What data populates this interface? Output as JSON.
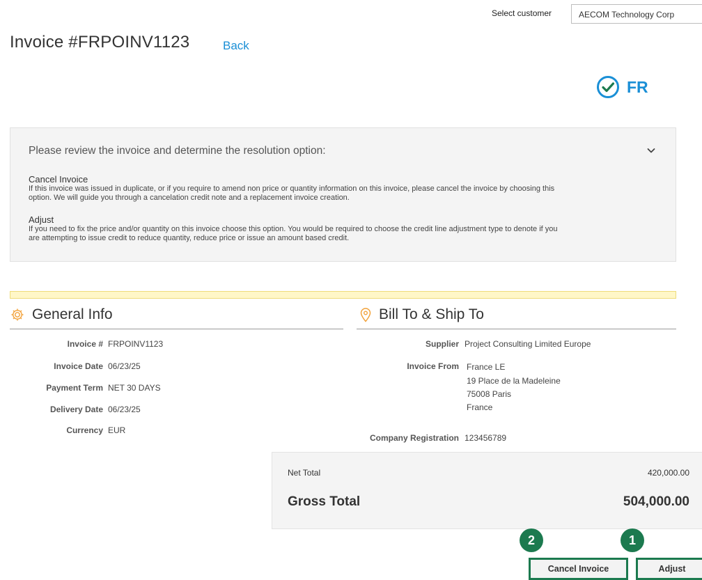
{
  "customer": {
    "label": "Select customer",
    "value": "AECOM Technology Corp"
  },
  "header": {
    "title": "Invoice #FRPOINV1123",
    "back_label": "Back"
  },
  "badge": {
    "country_code": "FR",
    "icon": "check-circle-icon",
    "color": "#1a8fd6"
  },
  "review": {
    "heading": "Please review the invoice and determine the resolution option:",
    "options": [
      {
        "title": "Cancel Invoice",
        "lines": [
          "If this invoice was issued in duplicate, or if you require to amend non price or quantity information on this invoice, please cancel the invoice by choosing this",
          "option. We will guide you through a cancelation credit note and a replacement invoice creation."
        ]
      },
      {
        "title": "Adjust",
        "lines": [
          "If you need to fix the price and/or quantity on this invoice choose this option. You would be required to choose the credit line adjustment type to denote if you",
          "are attempting to issue credit to reduce quantity, reduce price or issue an amount based credit."
        ]
      }
    ]
  },
  "general_info": {
    "title": "General Info",
    "icon": "gear-icon",
    "rows": [
      {
        "label": "Invoice #",
        "value": "FRPOINV1123"
      },
      {
        "label": "Invoice Date",
        "value": "06/23/25"
      },
      {
        "label": "Payment Term",
        "value": "NET 30 DAYS"
      },
      {
        "label": "Delivery Date",
        "value": "06/23/25"
      },
      {
        "label": "Currency",
        "value": "EUR"
      }
    ]
  },
  "bill_ship": {
    "title": "Bill To & Ship To",
    "icon": "location-pin-icon",
    "supplier_label": "Supplier",
    "supplier_value": "Project Consulting Limited Europe",
    "invoice_from_label": "Invoice From",
    "invoice_from_lines": [
      "France LE",
      "19 Place de la Madeleine",
      "75008 Paris",
      "France"
    ],
    "company_reg_label": "Company Registration",
    "company_reg_value": "123456789"
  },
  "totals": {
    "net_label": "Net Total",
    "net_value": "420,000.00",
    "gross_label": "Gross Total",
    "gross_value": "504,000.00"
  },
  "actions": {
    "cancel_label": "Cancel Invoice",
    "cancel_step": "2",
    "adjust_label": "Adjust",
    "adjust_step": "1"
  },
  "colors": {
    "accent_blue": "#1a8fd6",
    "step_green": "#1c7a4f",
    "icon_orange": "#f2a23a",
    "notice_yellow": "#fff7c8"
  }
}
